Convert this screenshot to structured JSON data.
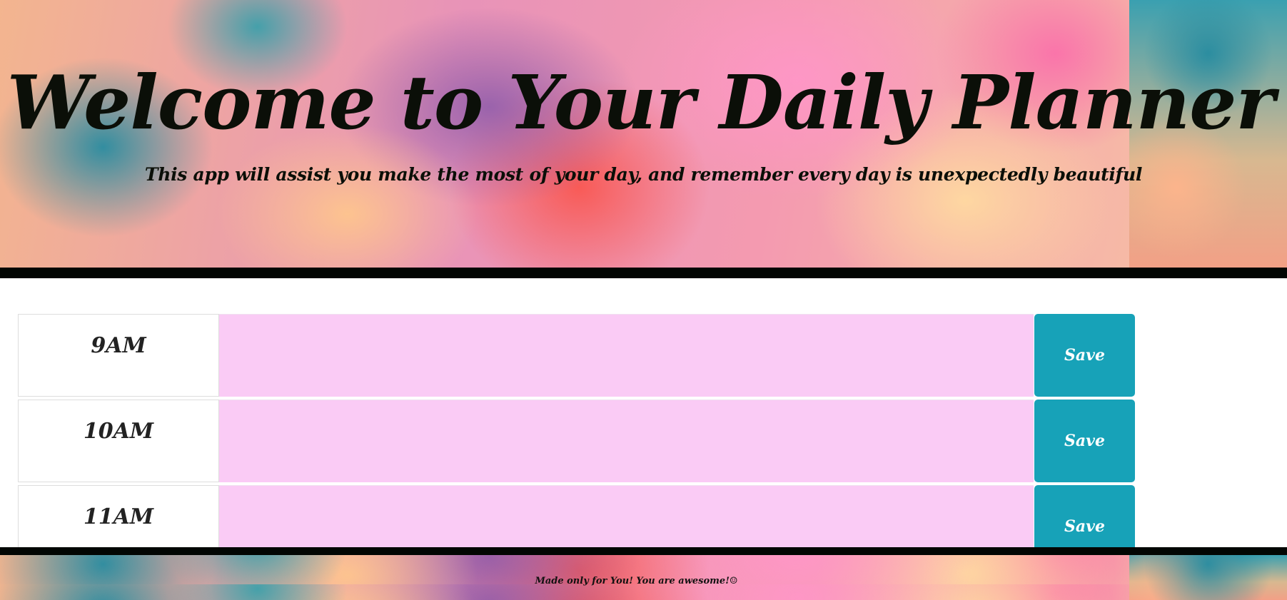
{
  "header": {
    "title": "Welcome to Your Daily Planner",
    "lead": "This app will assist you make the most of your day, and remember every day is unexpectedly beautiful"
  },
  "timeblocks": [
    {
      "hour": "9AM",
      "task": "",
      "save_label": "Save"
    },
    {
      "hour": "10AM",
      "task": "",
      "save_label": "Save"
    },
    {
      "hour": "11AM",
      "task": "",
      "save_label": "Save"
    }
  ],
  "footer": {
    "text": "Made only for You! You are awesome!☺"
  },
  "colors": {
    "past_present_future_bg": "#facbf5",
    "save_button": "#17a2b8",
    "divider": "#020603"
  }
}
